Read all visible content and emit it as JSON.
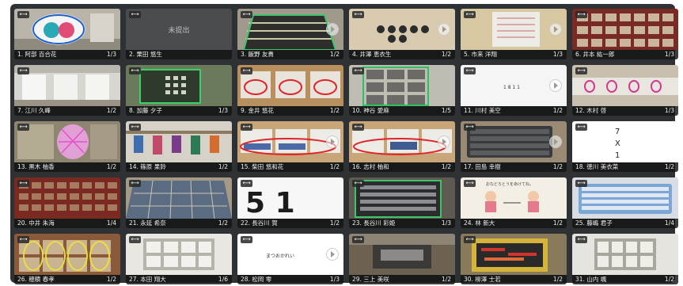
{
  "tile_tag": "⟷",
  "submissions": [
    {
      "label": "1. 阿部 百合花",
      "page": "1/3"
    },
    {
      "label": "2. 栗田 悠生",
      "page": "",
      "status": "未提出"
    },
    {
      "label": "3. 飯野 友貴",
      "page": "1/2"
    },
    {
      "label": "4. 井澤 恵衣生",
      "page": "1/2"
    },
    {
      "label": "5. 市来 洋翔",
      "page": "1/3"
    },
    {
      "label": "6. 井本 紘一郎",
      "page": "1/3"
    },
    {
      "label": "7. 江川 久峰",
      "page": "1/2"
    },
    {
      "label": "8. 加藤 夕子",
      "page": "1/3"
    },
    {
      "label": "9. 金井 悠花",
      "page": "1/2"
    },
    {
      "label": "10. 神谷 愛麻",
      "page": "1/5"
    },
    {
      "label": "11. 川村 美空",
      "page": "1/2",
      "photo_text": "1 8 1 1"
    },
    {
      "label": "12. 木村 啓",
      "page": "1/3"
    },
    {
      "label": "13. 黒木 柚香",
      "page": "1/2"
    },
    {
      "label": "14. 篠原 果鈴",
      "page": "1/2"
    },
    {
      "label": "15. 柴田 悠和花",
      "page": "1/2"
    },
    {
      "label": "16. 志村 柚和",
      "page": "1/2"
    },
    {
      "label": "17. 田島 幸樹",
      "page": "1/2"
    },
    {
      "label": "18. 徳川 美衣菜",
      "page": "1/2",
      "photo_text": "7\nX\n1"
    },
    {
      "label": "20. 中井 朱海",
      "page": "1/4"
    },
    {
      "label": "21. 永延 希奈",
      "page": "1/2"
    },
    {
      "label": "22. 長谷川 賀",
      "page": "1/2",
      "photo_text": "5 1"
    },
    {
      "label": "23. 長谷川 彩姫",
      "page": "1/3"
    },
    {
      "label": "24. 林 新大",
      "page": "1/2",
      "photo_text": "おなどろとうをあけてね。"
    },
    {
      "label": "25. 藤嶋 君子",
      "page": "1/4"
    },
    {
      "label": "26. 穂積 春孝",
      "page": "1/2"
    },
    {
      "label": "27. 本田 翔大",
      "page": "1/6"
    },
    {
      "label": "28. 松岡 零",
      "page": "1/3",
      "photo_text": "まつおかれい"
    },
    {
      "label": "29. 三上 美咲",
      "page": "1/2"
    },
    {
      "label": "30. 柳澤 士若",
      "page": "1/2"
    },
    {
      "label": "31. 山内 颯",
      "page": "1/2"
    }
  ]
}
